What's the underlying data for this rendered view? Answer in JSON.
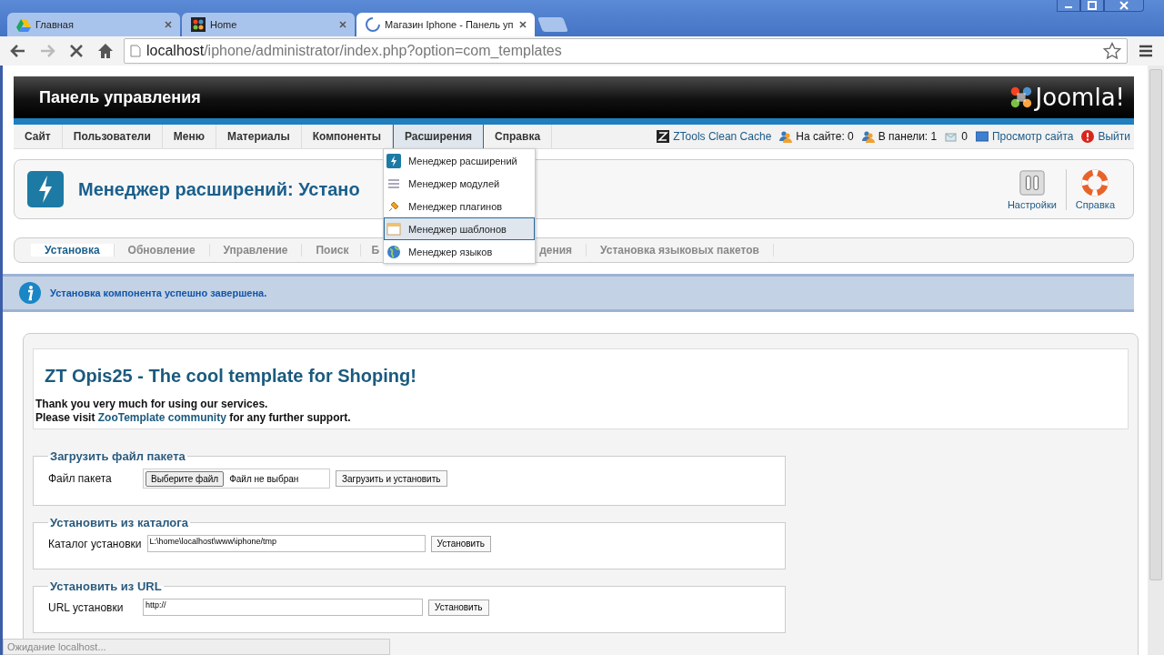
{
  "browser": {
    "tabs": [
      {
        "title": "Главная",
        "selected": false,
        "kind": "drive"
      },
      {
        "title": "Home",
        "selected": false,
        "kind": "joomla"
      },
      {
        "title": "Магазин Iphone - Панель уп",
        "selected": true,
        "kind": "loading"
      }
    ],
    "url": {
      "host": "localhost",
      "path": "/iphone/administrator/index.php?option=com_templates"
    },
    "status": "Ожидание localhost..."
  },
  "header": {
    "title": "Панель управления",
    "logo": "Joomla!"
  },
  "menu": [
    {
      "label": "Сайт",
      "selected": false
    },
    {
      "label": "Пользователи",
      "selected": false
    },
    {
      "label": "Меню",
      "selected": false
    },
    {
      "label": "Материалы",
      "selected": false
    },
    {
      "label": "Компоненты",
      "selected": false
    },
    {
      "label": "Расширения",
      "selected": true
    },
    {
      "label": "Справка",
      "selected": false
    }
  ],
  "status_items": [
    {
      "label": "ZTools Clean Cache",
      "kind": "ztools"
    },
    {
      "label": "На сайте: 0",
      "kind": "users"
    },
    {
      "label": "В панели: 1",
      "kind": "admins"
    },
    {
      "label": "0",
      "kind": "messages"
    },
    {
      "label": "Просмотр сайта",
      "kind": "view"
    },
    {
      "label": "Выйти",
      "kind": "logout"
    }
  ],
  "dropdown": [
    {
      "label": "Менеджер расширений",
      "selected": false,
      "kind": "extensions"
    },
    {
      "label": "Менеджер модулей",
      "selected": false,
      "kind": "modules"
    },
    {
      "label": "Менеджер плагинов",
      "selected": false,
      "kind": "plugins"
    },
    {
      "label": "Менеджер шаблонов",
      "selected": true,
      "kind": "templates"
    },
    {
      "label": "Менеджер языков",
      "selected": false,
      "kind": "languages"
    }
  ],
  "toolbar": {
    "title": "Менеджер расширений: Устано",
    "buttons": [
      {
        "label": "Настройки",
        "kind": "options"
      },
      {
        "label": "Справка",
        "kind": "help"
      }
    ]
  },
  "subnav": [
    {
      "label": "Установка",
      "selected": true
    },
    {
      "label": "Обновление",
      "selected": false
    },
    {
      "label": "Управление",
      "selected": false
    },
    {
      "label": "Поиск",
      "selected": false
    },
    {
      "label": "Б",
      "selected": false
    },
    {
      "label": "дения",
      "selected": false
    },
    {
      "label": "Установка языковых пакетов",
      "selected": false
    }
  ],
  "message": "Установка компонента успешно завершена.",
  "content": {
    "heading": "ZT Opis25 - The cool template for Shoping!",
    "line1": "Thank you very much for using our services.",
    "visit_before": "Please visit",
    "link": "ZooTemplate community",
    "visit_after": "for any further support."
  },
  "fieldsets": [
    {
      "legend": "Загрузить файл пакета",
      "label": "Файл пакета",
      "kind": "file",
      "choose": "Выберите файл",
      "value": "Файл не выбран",
      "action": "Загрузить и установить"
    },
    {
      "legend": "Установить из каталога",
      "label": "Каталог установки",
      "kind": "path",
      "value": "L:\\home\\localhost\\www\\iphone/tmp",
      "action": "Установить"
    },
    {
      "legend": "Установить из URL",
      "label": "URL установки",
      "kind": "url",
      "value": "http://",
      "action": "Установить"
    }
  ]
}
